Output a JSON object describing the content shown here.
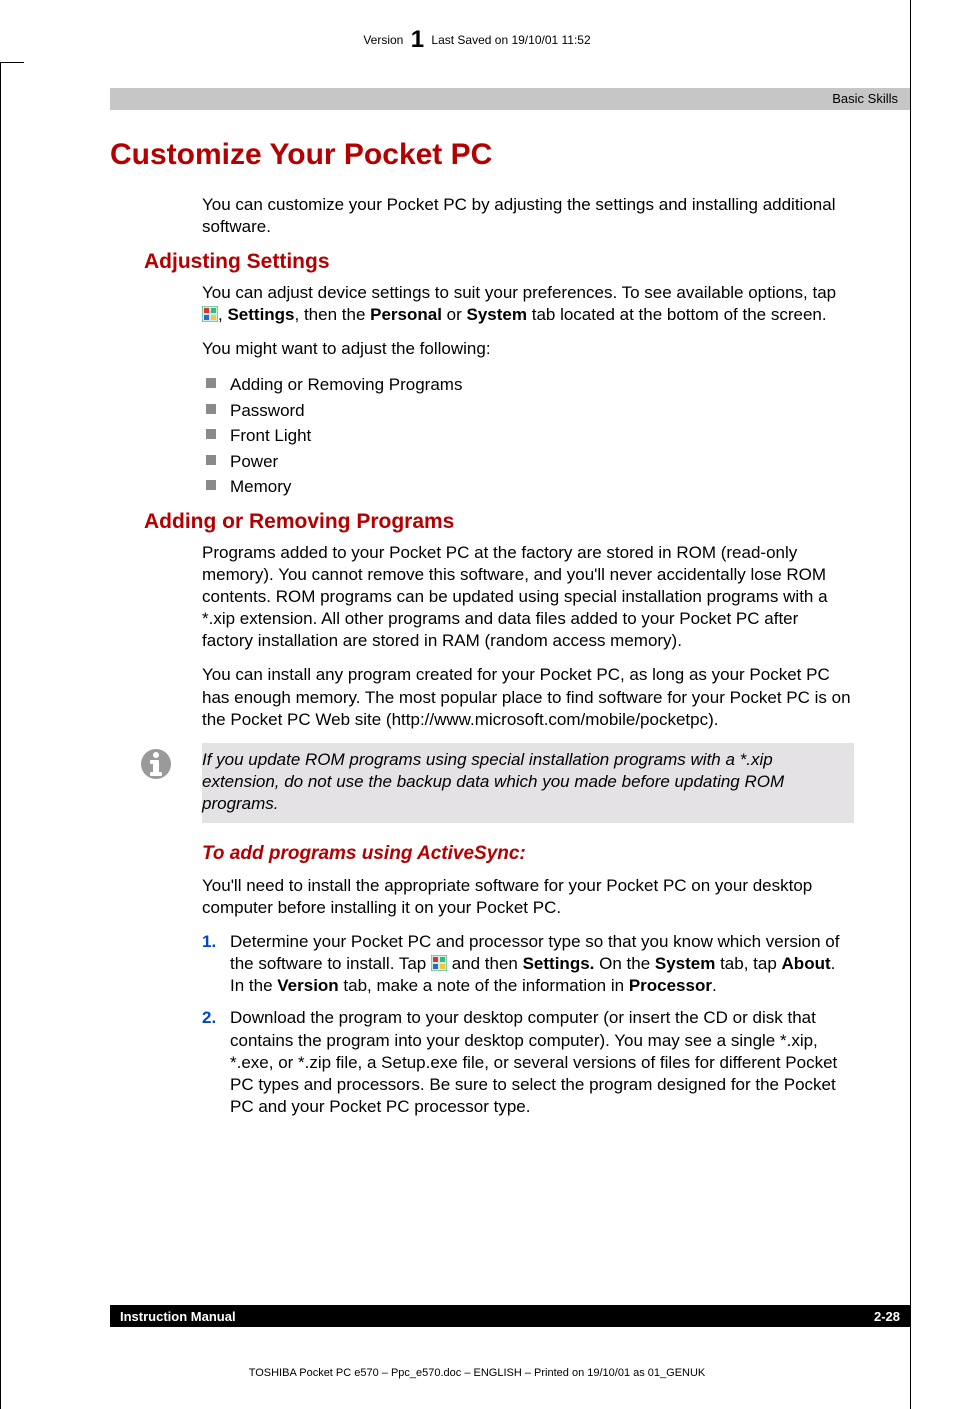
{
  "meta": {
    "version_label": "Version",
    "version_number": "1",
    "last_saved": "Last Saved on 19/10/01 11:52"
  },
  "header": {
    "breadcrumb": "Basic Skills"
  },
  "title": "Customize Your Pocket PC",
  "intro": "You can customize your Pocket PC by adjusting the settings and installing additional software.",
  "adjusting": {
    "heading": "Adjusting Settings",
    "p1_prefix": "You can adjust device settings to suit your preferences. To see available options, tap ",
    "p1_settings": "Settings",
    "p1_mid": ", then the ",
    "p1_personal": "Personal",
    "p1_or": " or ",
    "p1_system": "System",
    "p1_suffix": " tab located at the bottom of the screen.",
    "p2": "You might want to adjust the following:",
    "items": [
      "Adding or Removing Programs",
      "Password",
      "Front Light",
      "Power",
      "Memory"
    ]
  },
  "adding": {
    "heading": "Adding or Removing Programs",
    "p1": "Programs added to your Pocket PC at the factory are stored in ROM (read-only memory). You cannot remove this software, and you'll never accidentally lose ROM contents. ROM programs can be updated using special installation programs with a *.xip extension. All other programs and data files added to your Pocket PC after factory installation are stored in RAM (random access memory).",
    "p2": "You can install any program created for your Pocket PC, as long as your Pocket PC has enough memory. The most popular place to find software for your Pocket PC is on the Pocket PC Web site (http://www.microsoft.com/mobile/pocketpc).",
    "note": "If you update ROM programs using special installation programs with a *.xip extension, do not use the backup data which you made before updating ROM programs."
  },
  "activesync": {
    "heading": "To add programs using ActiveSync:",
    "intro": "You'll need to install the appropriate software for your Pocket PC on your desktop computer before installing it on your Pocket PC.",
    "step1": {
      "num": "1.",
      "pre": "Determine your Pocket PC and processor type so that you know which version of the software to install. Tap ",
      "and_then": " and then ",
      "settings": "Settings.",
      "on_the": " On the ",
      "system": "System",
      "tab_tap": " tab, tap ",
      "about": "About",
      "in_the": ". In the ",
      "version": "Version",
      "tab_note": " tab, make a note of the information in ",
      "processor": "Processor",
      "end": "."
    },
    "step2": {
      "num": "2.",
      "text": "Download the program to your desktop computer (or insert the CD or disk that contains the program into your desktop computer). You may see a single *.xip, *.exe, or *.zip file, a Setup.exe file, or several versions of files for different Pocket PC types and processors. Be sure to select the program designed for the Pocket PC and your Pocket PC processor type."
    }
  },
  "footer": {
    "left": "Instruction Manual",
    "right": "2-28"
  },
  "bottom": "TOSHIBA Pocket PC e570  – Ppc_e570.doc – ENGLISH – Printed on 19/10/01 as 01_GENUK",
  "icons": {
    "start": "start-flag-icon",
    "info": "info-icon"
  }
}
